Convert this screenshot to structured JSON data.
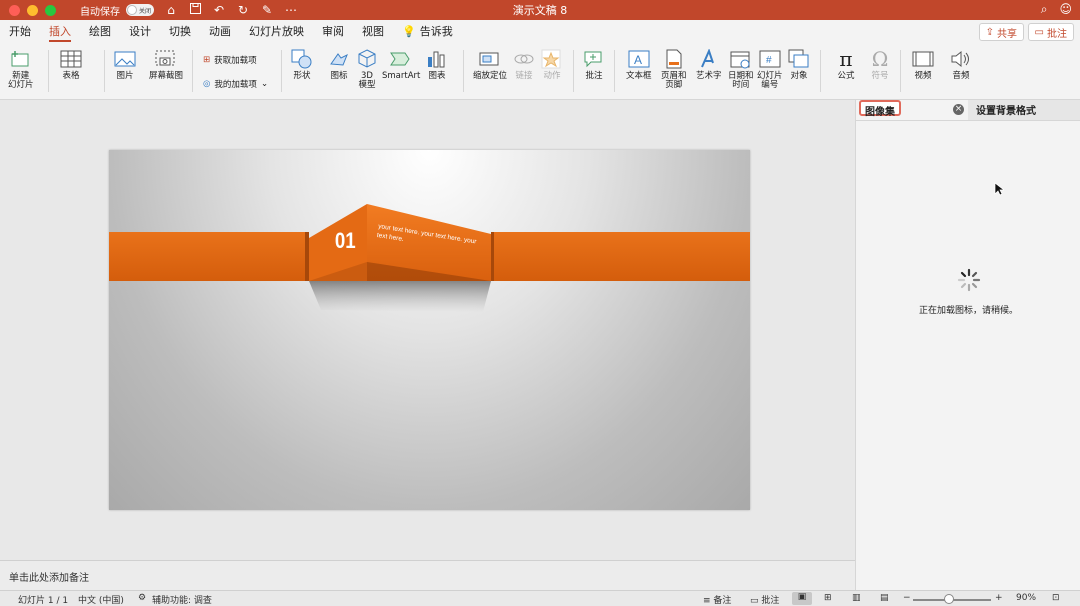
{
  "titlebar": {
    "autosave_label": "自动保存",
    "autosave_state": "关闭",
    "doc_title": "演示文稿 8"
  },
  "menu": {
    "tabs": [
      "开始",
      "插入",
      "绘图",
      "设计",
      "切换",
      "动画",
      "幻灯片放映",
      "审阅",
      "视图"
    ],
    "active_tab": "插入",
    "tell_me": "告诉我",
    "share": "共享",
    "comments": "批注"
  },
  "ribbon": {
    "new_slide": "新建\n幻灯片",
    "table": "表格",
    "pictures": "图片",
    "screenshot": "屏幕截图",
    "get_addins": "获取加载项",
    "my_addins": "我的加载项",
    "shapes": "形状",
    "icons": "图标",
    "model_3d": "3D\n模型",
    "smartart": "SmartArt",
    "chart": "图表",
    "zoom": "缩放定位",
    "link": "链接",
    "action": "动作",
    "comment": "批注",
    "textbox": "文本框",
    "header_footer": "页眉和\n页脚",
    "wordart": "艺术字",
    "date_time": "日期和\n时间",
    "slide_number": "幻灯片\n编号",
    "object": "对象",
    "equation": "公式",
    "symbol": "符号",
    "video": "视频",
    "audio": "音频"
  },
  "slide": {
    "number_label": "01",
    "body_text": "your text here. your text here. your text here."
  },
  "notes": {
    "placeholder": "单击此处添加备注"
  },
  "pane": {
    "tab_active": "图像集",
    "tab_other": "设置背景格式",
    "loading_text": "正在加载图标，请稍候。"
  },
  "statusbar": {
    "slide_info": "幻灯片 1 / 1",
    "language": "中文 (中国)",
    "accessibility": "辅助功能: 调查",
    "notes_btn": "备注",
    "comments_btn": "批注",
    "zoom_level": "90%"
  },
  "colors": {
    "brand": "#c1472b",
    "slide_orange": "#e8701a"
  }
}
